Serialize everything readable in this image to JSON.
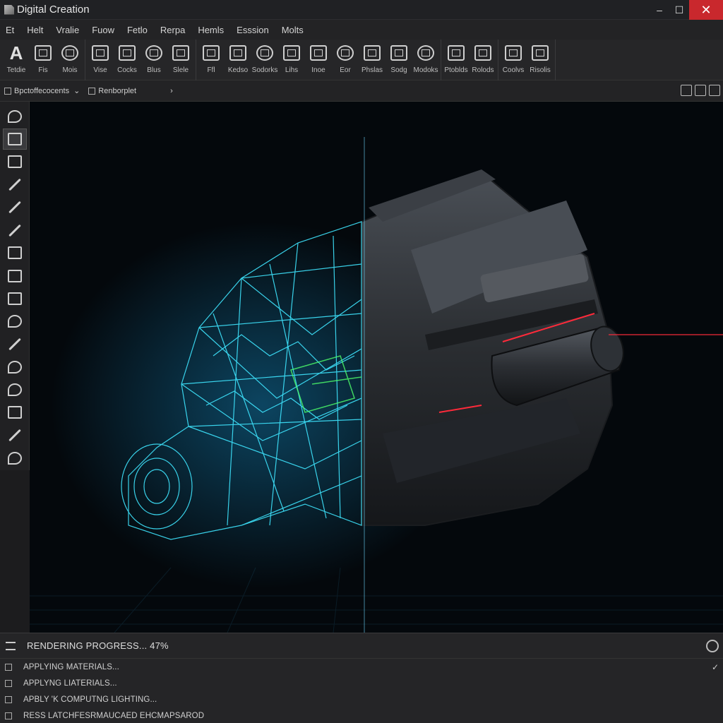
{
  "window": {
    "title": "Digital Creation",
    "controls": {
      "minimize": "–",
      "maximize": "☐",
      "close": "✕"
    }
  },
  "menu": [
    "Et",
    "Helt",
    "Vralie",
    "Fuow",
    "Fetlo",
    "Rerpa",
    "Hemls",
    "Esssion",
    "Molts"
  ],
  "ribbon": {
    "groups": [
      [
        {
          "label": "Tetdie",
          "icon": "text-tool-icon"
        },
        {
          "label": "Fis",
          "icon": "monitor-icon"
        },
        {
          "label": "Mois",
          "icon": "shapes-icon"
        }
      ],
      [
        {
          "label": "Vise",
          "icon": "grid-icon"
        },
        {
          "label": "Cocks",
          "icon": "folder-icon"
        },
        {
          "label": "Blus",
          "icon": "layers-icon"
        },
        {
          "label": "Slele",
          "icon": "image-icon"
        }
      ],
      [
        {
          "label": "Ffl",
          "icon": "transform-icon"
        },
        {
          "label": "Kedso",
          "icon": "brush-icon"
        },
        {
          "label": "Sodorks",
          "icon": "nodes-icon"
        },
        {
          "label": "Lihs",
          "icon": "folder-open-icon"
        },
        {
          "label": "Inoe",
          "icon": "particles-icon"
        },
        {
          "label": "Eor",
          "icon": "pin-icon"
        },
        {
          "label": "Phslas",
          "icon": "document-icon"
        },
        {
          "label": "Sodg",
          "icon": "camera-icon"
        },
        {
          "label": "Modoks",
          "icon": "hierarchy-icon"
        }
      ],
      [
        {
          "label": "Ptoblds",
          "icon": "render-icon"
        },
        {
          "label": "Rolods",
          "icon": "mesh-icon"
        }
      ],
      [
        {
          "label": "Coolvs",
          "icon": "list-icon"
        },
        {
          "label": "Risolis",
          "icon": "settings-icon"
        }
      ]
    ]
  },
  "options": {
    "left_dropdown": "Bpctoffecocents",
    "right_dropdown": "Renborplet",
    "arrow": "›",
    "dropdown_caret": "⌄"
  },
  "status": {
    "progress_label": "RENDERING PROGRESS... 47%",
    "progress_percent": 47,
    "log": [
      {
        "text": "APPLYING MATERIALS...",
        "done": true,
        "check": "✓"
      },
      {
        "text": "APPLYNG LIATERIALS...",
        "done": false,
        "check": ""
      },
      {
        "text": "APBLY 'K COMPUTNG LIGHTING...",
        "done": false,
        "check": ""
      },
      {
        "text": "RESS LATCHFESRMAUCAED EHCMAPSAROD",
        "done": false,
        "check": ""
      }
    ]
  },
  "colors": {
    "wireframe": "#3fe6ff",
    "wire_glow": "#1bb6ff",
    "inner_green": "#4dff6a",
    "body_dark": "#2a2d31",
    "accent_red": "#ff2a3a",
    "close_red": "#c9282d"
  }
}
